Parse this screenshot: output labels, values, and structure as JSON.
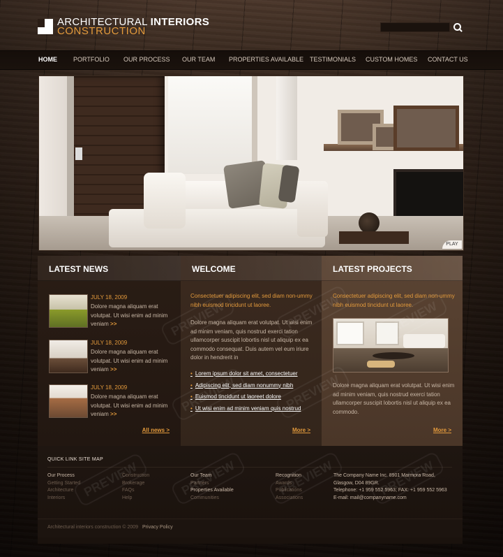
{
  "header": {
    "logo_line1_a": "ARCHITECTURAL",
    "logo_line1_b": "INTERIORS",
    "logo_line2": "CONSTRUCTION"
  },
  "nav": [
    "HOME",
    "PORTFOLIO",
    "OUR PROCESS",
    "OUR TEAM",
    "PROPERTIES AVAILABLE",
    "TESTIMONIALS",
    "CUSTOM HOMES",
    "CONTACT US"
  ],
  "hero": {
    "play_label": "PLAY"
  },
  "latest_news": {
    "heading": "LATEST NEWS",
    "items": [
      {
        "date": "JULY 18, 2009",
        "text": "Dolore magna aliquam erat volutpat. Ut wisi enim ad minim veniam",
        "more": ">>"
      },
      {
        "date": "JULY 18, 2009",
        "text": "Dolore magna aliquam erat volutpat. Ut wisi enim ad minim veniam",
        "more": ">>"
      },
      {
        "date": "JULY 18, 2009",
        "text": "Dolore magna aliquam erat volutpat. Ut wisi enim ad minim veniam",
        "more": ">>"
      }
    ],
    "all_news": "All news >"
  },
  "welcome": {
    "heading": "WELCOME",
    "lead": "Consectetuer adipiscing elit, sed diam non-ummy nibh euismod tincidunt ut laoree.",
    "body": "Dolore magna aliquam erat volutpat. Ut wisi enim ad minim veniam, quis nostrud exerci tation ullamcorper suscipit lobortis nisl ut aliquip ex ea commodo consequat. Duis autem vel eum iriure dolor in hendrerit in",
    "bullets": [
      "Lorem ipsum dolor sit amet, consectetuer",
      "Adipiscing elit, sed diam nonummy nibh",
      "Euismod tincidunt ut laoreet dolore",
      "Ut wisi enim ad minim veniam quis nostrud"
    ],
    "more": "More >"
  },
  "latest_projects": {
    "heading": "LATEST PROJECTS",
    "lead": "Consectetuer adipiscing elit, sed diam non-ummy nibh euismod tincidunt ut laoree.",
    "body": "Dolore magna aliquam erat volutpat. Ut wisi enim ad minim veniam, quis nostrud exerci tation ullamcorper suscipit lobortis nisl ut aliquip ex ea commodo.",
    "more": "More >"
  },
  "footer": {
    "heading": "QUICK LINK SITE MAP",
    "col1": [
      "Our Process",
      "Getting Started",
      "Architecture",
      "Interiors"
    ],
    "col2": [
      "Construction",
      "Brokerage",
      "FAQs",
      "Help"
    ],
    "col3": [
      "Our Team",
      "Partners",
      "Properties Available",
      "Communities"
    ],
    "col4": [
      "Recognition",
      "Awards",
      "Publications",
      "Associations"
    ],
    "address": [
      "The Company Name Inc. 8901 Marmora Road,",
      "Glasgow, D04 89GR.",
      "Telephone: +1 959 552 5963; FAX: +1 959 552 5963",
      "E-mail: mail@companyname.com"
    ],
    "copyright": "Architectural interiors construction © 2009",
    "privacy": "Privacy Policy"
  },
  "watermark": "PREVIEW",
  "colors": {
    "accent": "#e39a3c",
    "background": "#1a110c"
  }
}
